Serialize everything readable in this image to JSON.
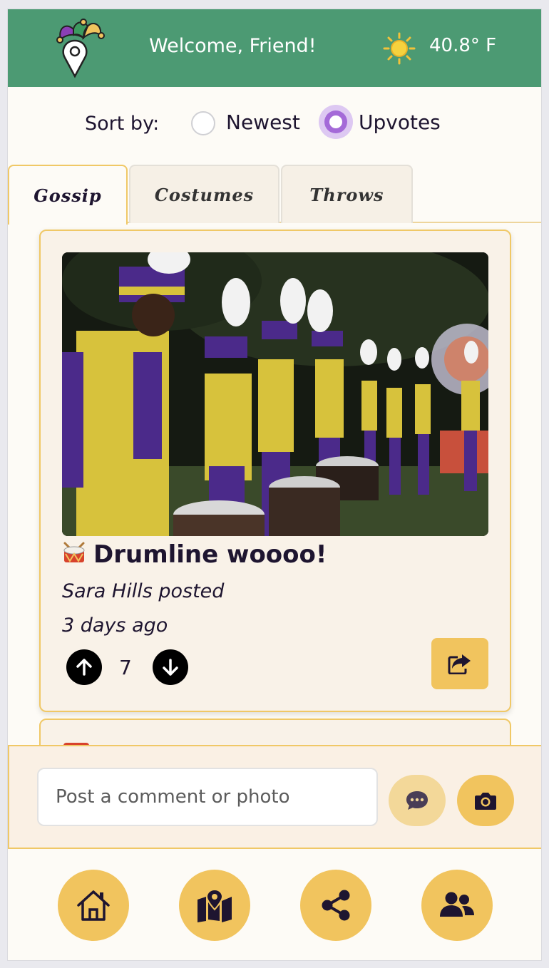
{
  "header": {
    "welcome": "Welcome, Friend!",
    "temperature": "40.8° F",
    "logo_icon": "jester-hat-location-pin-icon",
    "weather_icon": "sun-icon",
    "background_color": "#4c9a73"
  },
  "sort": {
    "label": "Sort by:",
    "options": [
      {
        "label": "Newest",
        "selected": false
      },
      {
        "label": "Upvotes",
        "selected": true
      }
    ]
  },
  "tabs": [
    {
      "label": "Gossip",
      "active": true
    },
    {
      "label": "Costumes",
      "active": false
    },
    {
      "label": "Throws",
      "active": false
    }
  ],
  "post": {
    "emoji_icon": "drum-icon",
    "title": "Drumline woooo!",
    "author": "Sara Hills posted",
    "time": "3 days ago",
    "votes": "7",
    "photo_icon": "marching-band-photo"
  },
  "composer": {
    "placeholder": "Post a comment or photo",
    "chat_icon": "chat-bubble-icon",
    "camera_icon": "camera-icon"
  },
  "nav": [
    {
      "icon": "home-icon"
    },
    {
      "icon": "map-icon"
    },
    {
      "icon": "share-icon"
    },
    {
      "icon": "users-icon"
    }
  ],
  "colors": {
    "accent": "#f1c45e",
    "radio_selected": "#a46ad8",
    "card_border": "#f0c866"
  }
}
